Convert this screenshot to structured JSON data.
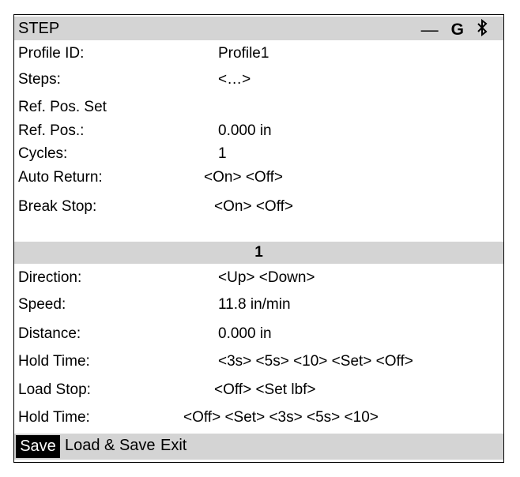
{
  "header": {
    "title": "STEP",
    "icons": {
      "dash": "—",
      "g": "G",
      "bluetooth": "✱"
    }
  },
  "fields": [
    {
      "label": "Profile ID:",
      "value": "Profile1"
    },
    {
      "label": "Steps:",
      "value": "<…>"
    },
    {
      "label": "Ref. Pos. Set",
      "value": ""
    },
    {
      "label": "Ref. Pos.:",
      "value": "0.000 in"
    },
    {
      "label": "Cycles:",
      "value": "1"
    },
    {
      "label": "Auto Return:",
      "value": "<On> <Off>"
    },
    {
      "label": "Break Stop:",
      "value": "<On> <Off>"
    }
  ],
  "step": {
    "number": "1",
    "fields": [
      {
        "label": "Direction:",
        "value": "<Up> <Down>"
      },
      {
        "label": "Speed:",
        "value": "11.8 in/min"
      },
      {
        "label": "Distance:",
        "value": "0.000 in"
      },
      {
        "label": "Hold Time:",
        "value": "<3s> <5s> <10> <Set> <Off>"
      },
      {
        "label": "Load Stop:",
        "value": "<Off> <Set lbf>"
      },
      {
        "label": "Hold Time:",
        "value": "<Off> <Set> <3s> <5s> <10>"
      }
    ]
  },
  "footer": {
    "save_label": "Save",
    "load_save_label": "Load & Save",
    "exit_label": "Exit"
  }
}
